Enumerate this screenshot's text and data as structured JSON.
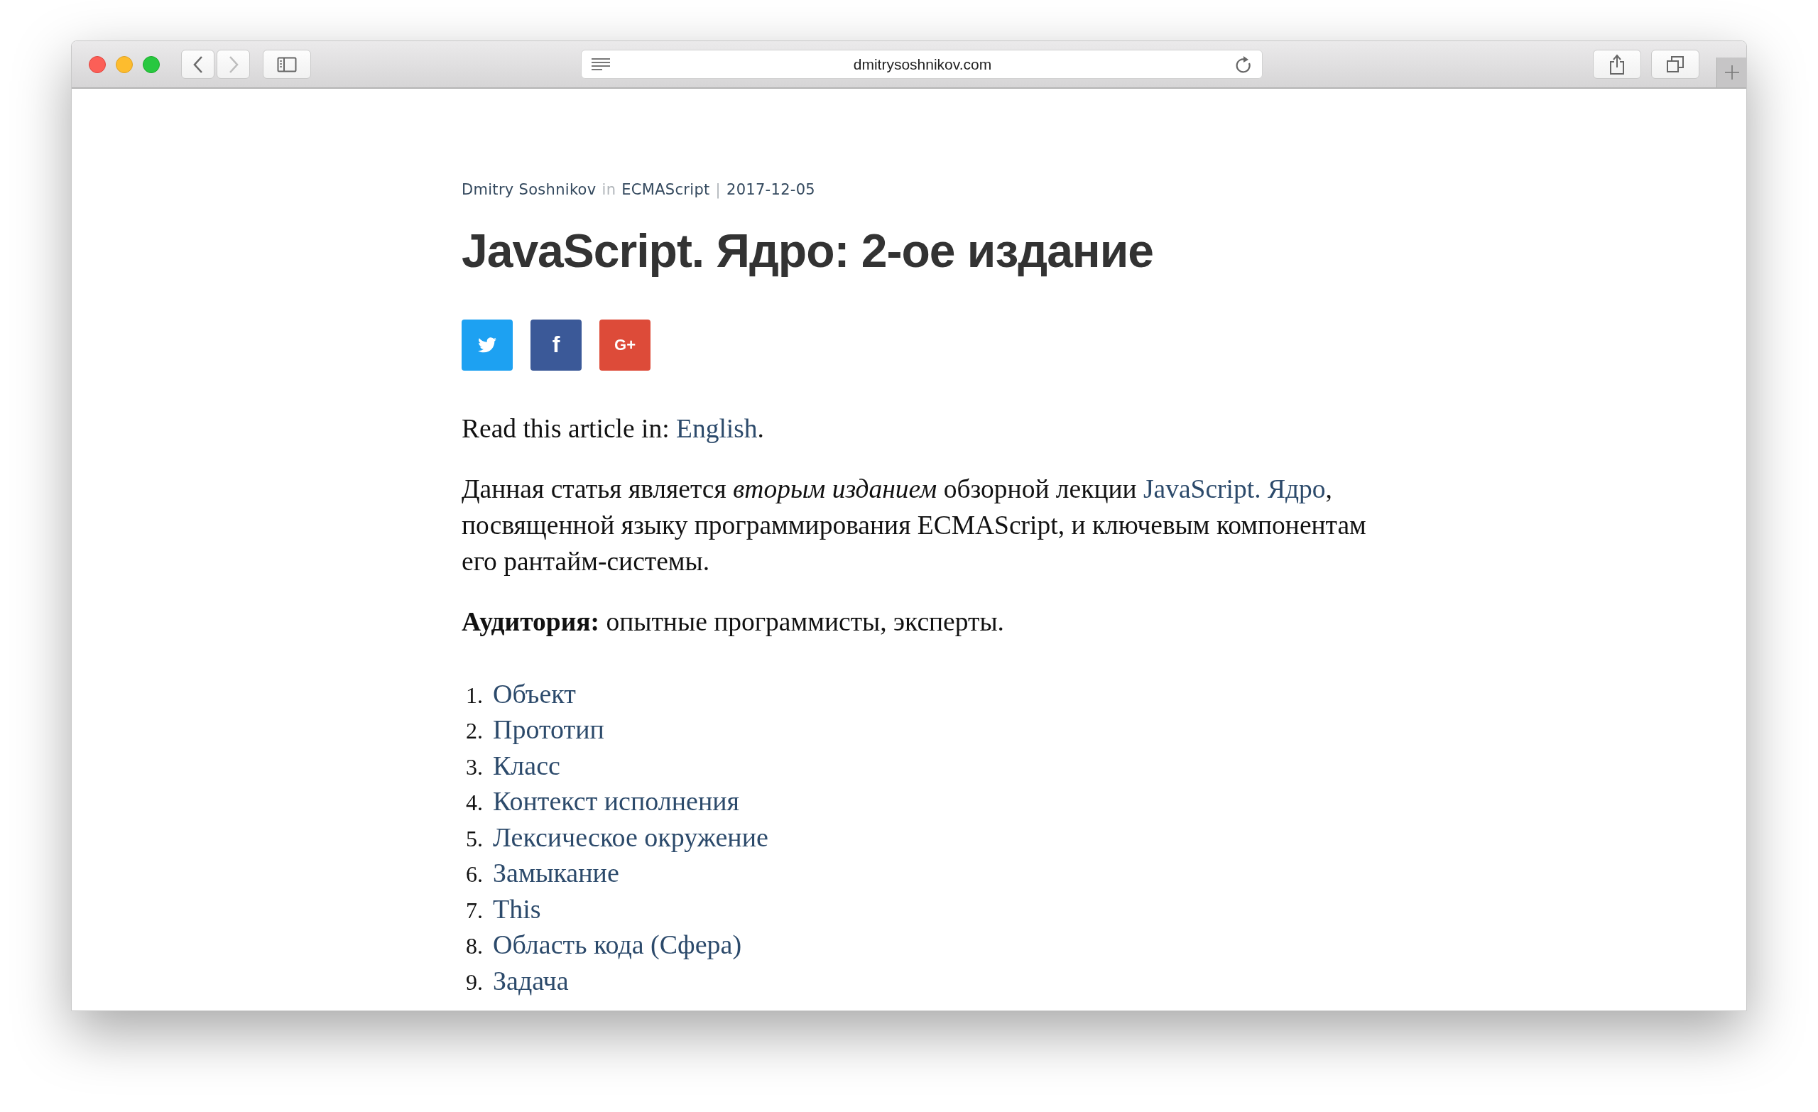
{
  "toolbar": {
    "back": {
      "disabled": false
    },
    "forward": {
      "disabled": true
    },
    "address": "dmitrysoshnikov.com"
  },
  "meta": {
    "author": "Dmitry Soshnikov",
    "in": "in",
    "category": "ECMAScript",
    "separator": "|",
    "date": "2017-12-05"
  },
  "title": "JavaScript. Ядро: 2-ое издание",
  "share_buttons": [
    {
      "kind": "twitter",
      "color": "#1da1f2"
    },
    {
      "kind": "facebook",
      "label": "f",
      "color": "#3b5998"
    },
    {
      "kind": "google",
      "label": "G+",
      "color": "#dd4b39"
    }
  ],
  "paragraphs": [
    [
      {
        "kind": "text",
        "text": "Read this article in: "
      },
      {
        "kind": "link",
        "text": "English"
      },
      {
        "kind": "text",
        "text": "."
      }
    ],
    [
      {
        "kind": "text",
        "text": "Данная статья является *вторым изданием* обзорной лекции "
      },
      {
        "kind": "link",
        "text": "JavaScript. Ядро"
      },
      {
        "kind": "text",
        "text": ", посвященной языку программирования ECMAScript, и ключевым компонентам его рантайм-системы."
      }
    ],
    [
      {
        "kind": "text",
        "text": "**Аудитория:** опытные программисты, эксперты."
      }
    ]
  ],
  "contents": [
    {
      "number": "1.",
      "title": "Объект"
    },
    {
      "number": "2.",
      "title": "Прототип"
    },
    {
      "number": "3.",
      "title": "Класс"
    },
    {
      "number": "4.",
      "title": "Контекст исполнения"
    },
    {
      "number": "5.",
      "title": "Лексическое окружение"
    },
    {
      "number": "6.",
      "title": "Замыкание"
    },
    {
      "number": "7.",
      "title": "This"
    },
    {
      "number": "8.",
      "title": "Область кода (Сфера)"
    },
    {
      "number": "9.",
      "title": "Задача"
    }
  ]
}
